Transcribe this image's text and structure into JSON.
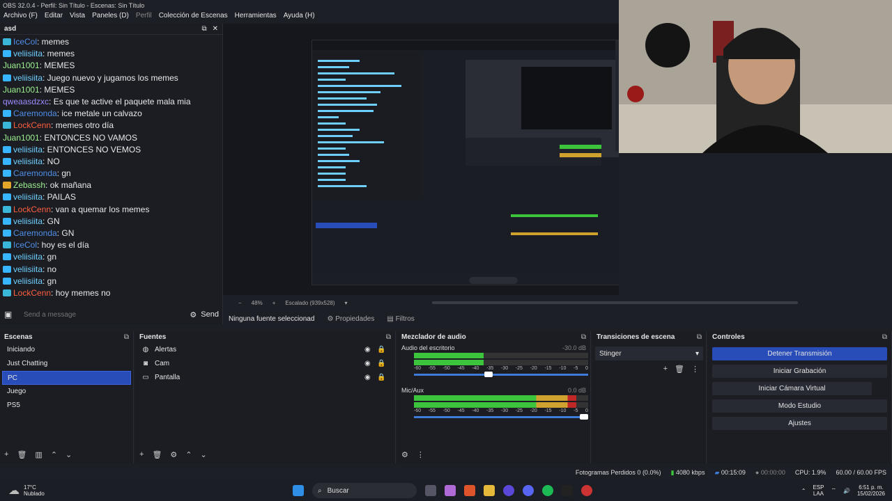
{
  "window": {
    "title": "OBS 32.0.4 - Perfil: Sin Título - Escenas: Sin Título"
  },
  "menu": [
    {
      "label": "Archivo (F)",
      "enabled": true
    },
    {
      "label": "Editar",
      "enabled": true
    },
    {
      "label": "Vista",
      "enabled": true
    },
    {
      "label": "Paneles (D)",
      "enabled": true
    },
    {
      "label": "Perfil",
      "enabled": false
    },
    {
      "label": "Colección de Escenas",
      "enabled": true
    },
    {
      "label": "Herramientas",
      "enabled": true
    },
    {
      "label": "Ayuda (H)",
      "enabled": true
    }
  ],
  "chat": {
    "title": "asd",
    "input_placeholder": "Send a message",
    "send_label": "Send",
    "messages": [
      {
        "user": "IceCol",
        "text": "memes",
        "color": "#4f8fe8",
        "badge": "#3ab6d8"
      },
      {
        "user": "veliisiita",
        "text": "memes",
        "color": "#6fd0ff",
        "badge": "#37b5ff"
      },
      {
        "user": "Juan1001",
        "text": "MEMES",
        "color": "#9df28f",
        "badge": ""
      },
      {
        "user": "veliisiita",
        "text": "Juego nuevo y jugamos los memes",
        "color": "#6fd0ff",
        "badge": "#37b5ff"
      },
      {
        "user": "Juan1001",
        "text": "MEMES",
        "color": "#9df28f",
        "badge": ""
      },
      {
        "user": "qweaasdzxc",
        "text": "Es que te active el paquete mala mia",
        "color": "#9a8cff",
        "badge": ""
      },
      {
        "user": "Caremonda",
        "text": "ice metale un calvazo",
        "color": "#4f8fe8",
        "badge": "#37b5ff"
      },
      {
        "user": "LockCenn",
        "text": "memes otro día",
        "color": "#ff5f3f",
        "badge": "#3ab6d8"
      },
      {
        "user": "Juan1001",
        "text": "ENTONCES NO VAMOS",
        "color": "#9df28f",
        "badge": ""
      },
      {
        "user": "veliisiita",
        "text": "ENTONCES NO VEMOS",
        "color": "#6fd0ff",
        "badge": "#37b5ff"
      },
      {
        "user": "veliisiita",
        "text": "NO",
        "color": "#6fd0ff",
        "badge": "#37b5ff"
      },
      {
        "user": "Caremonda",
        "text": "gn",
        "color": "#4f8fe8",
        "badge": "#37b5ff"
      },
      {
        "user": "Zebassh",
        "text": "ok mañana",
        "color": "#9df28f",
        "badge": "#e2a529"
      },
      {
        "user": "veliisiita",
        "text": "PAILAS",
        "color": "#6fd0ff",
        "badge": "#37b5ff"
      },
      {
        "user": "LockCenn",
        "text": "van a quemar los memes",
        "color": "#ff5f3f",
        "badge": "#3ab6d8"
      },
      {
        "user": "veliisiita",
        "text": "GN",
        "color": "#6fd0ff",
        "badge": "#37b5ff"
      },
      {
        "user": "Caremonda",
        "text": "GN",
        "color": "#4f8fe8",
        "badge": "#37b5ff"
      },
      {
        "user": "IceCol",
        "text": "hoy es el día",
        "color": "#4f8fe8",
        "badge": "#3ab6d8"
      },
      {
        "user": "veliisiita",
        "text": "gn",
        "color": "#6fd0ff",
        "badge": "#37b5ff"
      },
      {
        "user": "veliisiita",
        "text": "no",
        "color": "#6fd0ff",
        "badge": "#37b5ff"
      },
      {
        "user": "veliisiita",
        "text": "gn",
        "color": "#6fd0ff",
        "badge": "#37b5ff"
      },
      {
        "user": "LockCenn",
        "text": "hoy memes no",
        "color": "#ff5f3f",
        "badge": "#3ab6d8"
      }
    ]
  },
  "preview": {
    "zoom": "48%",
    "scale": "Escalado (939x528)"
  },
  "source_bar": {
    "selection": "Ninguna fuente seleccionad",
    "properties": "Propiedades",
    "filters": "Filtros"
  },
  "scenes": {
    "title": "Escenas",
    "items": [
      "Iniciando",
      "Just Chatting",
      "PC",
      "Juego",
      "PS5"
    ],
    "selected_index": 2
  },
  "sources": {
    "title": "Fuentes",
    "items": [
      {
        "name": "Alertas",
        "icon": "globe-icon"
      },
      {
        "name": "Cam",
        "icon": "camera-icon"
      },
      {
        "name": "Pantalla",
        "icon": "monitor-icon"
      }
    ]
  },
  "mixer": {
    "title": "Mezclador de audio",
    "ticks": [
      "-60",
      "-55",
      "-50",
      "-45",
      "-40",
      "-35",
      "-30",
      "-25",
      "-20",
      "-15",
      "-10",
      "-5",
      "0"
    ],
    "channels": [
      {
        "name": "Audio del escritorio",
        "db": "-30.0 dB",
        "level": 0.4,
        "volume": 0.45
      },
      {
        "name": "Mic/Aux",
        "db": "0.0 dB",
        "level": 0.93,
        "volume": 1.0
      }
    ]
  },
  "transitions": {
    "title": "Transiciones de escena",
    "selected": "Stinger"
  },
  "controls": {
    "title": "Controles",
    "buttons": [
      "Detener Transmisión",
      "Iniciar Grabación",
      "Iniciar Cámara Virtual",
      "Modo Estudio",
      "Ajustes"
    ]
  },
  "status": {
    "dropped": "Fotogramas Perdidos 0 (0.0%)",
    "bitrate": "4080 kbps",
    "stream_time": "00:15:09",
    "rec_time": "00:00:00",
    "cpu": "CPU: 1.9%",
    "fps": "60.00 / 60.00 FPS"
  },
  "taskbar": {
    "temp": "17°C",
    "weather": "Nublado",
    "search": "Buscar",
    "lang1": "ESP",
    "lang2": "LAA",
    "time": "6:51 p. m.",
    "date": "15/02/2026"
  },
  "colors": {
    "accent": "#284cb8",
    "panel": "#1b1d23",
    "bg": "#1d1f26"
  }
}
